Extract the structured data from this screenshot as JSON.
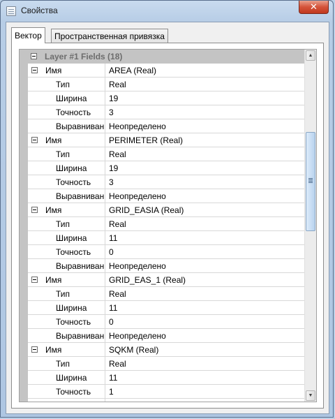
{
  "window": {
    "title": "Свойства",
    "close_glyph": "✕"
  },
  "tabs": [
    {
      "label": "Вектор",
      "active": true
    },
    {
      "label": "Пространственная привязка",
      "active": false
    }
  ],
  "property_grid": {
    "category_label": "Layer #1 Fields (18)",
    "fields": [
      {
        "name_label": "Имя",
        "name_value": "AREA (Real)",
        "props": [
          {
            "label": "Тип",
            "value": "Real"
          },
          {
            "label": "Ширина",
            "value": "19"
          },
          {
            "label": "Точность",
            "value": "3"
          },
          {
            "label": "Выравниван",
            "value": "Неопределено"
          }
        ]
      },
      {
        "name_label": "Имя",
        "name_value": "PERIMETER (Real)",
        "props": [
          {
            "label": "Тип",
            "value": "Real"
          },
          {
            "label": "Ширина",
            "value": "19"
          },
          {
            "label": "Точность",
            "value": "3"
          },
          {
            "label": "Выравниван",
            "value": "Неопределено"
          }
        ]
      },
      {
        "name_label": "Имя",
        "name_value": "GRID_EASIA (Real)",
        "props": [
          {
            "label": "Тип",
            "value": "Real"
          },
          {
            "label": "Ширина",
            "value": "11"
          },
          {
            "label": "Точность",
            "value": "0"
          },
          {
            "label": "Выравниван",
            "value": "Неопределено"
          }
        ]
      },
      {
        "name_label": "Имя",
        "name_value": "GRID_EAS_1 (Real)",
        "props": [
          {
            "label": "Тип",
            "value": "Real"
          },
          {
            "label": "Ширина",
            "value": "11"
          },
          {
            "label": "Точность",
            "value": "0"
          },
          {
            "label": "Выравниван",
            "value": "Неопределено"
          }
        ]
      },
      {
        "name_label": "Имя",
        "name_value": "SQKM (Real)",
        "props": [
          {
            "label": "Тип",
            "value": "Real"
          },
          {
            "label": "Ширина",
            "value": "11"
          },
          {
            "label": "Точность",
            "value": "1"
          },
          {
            "label": "Выравниван",
            "value": "Неопределено"
          }
        ]
      }
    ]
  },
  "scrollbar": {
    "up_arrow": "▲",
    "down_arrow": "▼"
  }
}
